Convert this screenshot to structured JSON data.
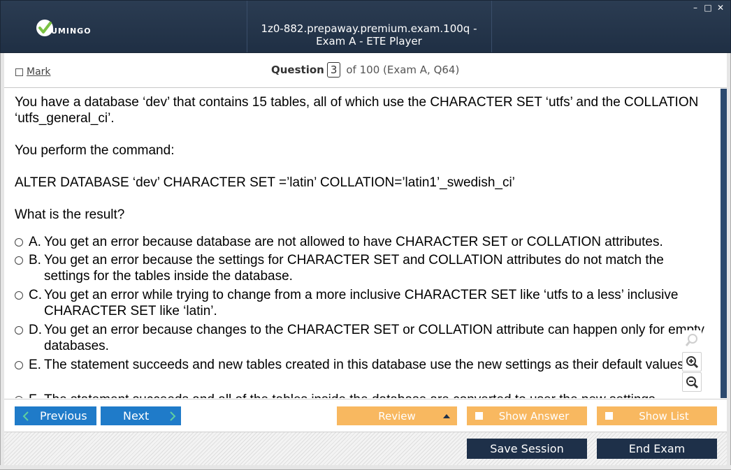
{
  "window": {
    "title": "1z0-882.prepaway.premium.exam.100q - Exam A - ETE Player",
    "logo_text": "UMINGO",
    "controls": [
      "–",
      "□",
      "✕"
    ]
  },
  "header": {
    "mark_label": "Mark",
    "question_label": "Question",
    "question_number": "3",
    "question_suffix": "of 100 (Exam A, Q64)"
  },
  "question": {
    "paragraphs": [
      "You have a database ‘dev’ that contains 15 tables, all of which use the CHARACTER SET ‘utfs’ and the COLLATION ‘utfs_general_ci’.",
      "You perform the command:",
      "ALTER DATABASE ‘dev’ CHARACTER SET =’latin’ COLLATION=’latin1’_swedish_ci’",
      "What is the result?"
    ],
    "options": [
      {
        "letter": "A.",
        "text": "You get an error because database are not allowed to have CHARACTER SET or COLLATION attributes."
      },
      {
        "letter": "B.",
        "text": "You get an error because the settings for CHARACTER SET and COLLATION attributes do not match the settings for the tables inside the database."
      },
      {
        "letter": "C.",
        "text": "You get an error while trying to change from a more inclusive CHARACTER SET like ‘utfs to a less’ inclusive CHARACTER SET like ‘latin’."
      },
      {
        "letter": "D.",
        "text": "You get an error because changes to the CHARACTER SET or COLLATION attribute can happen only for empty databases."
      },
      {
        "letter": "E.",
        "text": "The statement succeeds and new tables created in this database use the new settings as their default values."
      },
      {
        "letter": "F.",
        "text": "The statement succeeds and all of the tables inside the database are converted to user the new settings."
      }
    ]
  },
  "nav": {
    "previous_label": "Previous",
    "next_label": "Next",
    "review_label": "Review",
    "show_answer_label": "Show Answer",
    "show_list_label": "Show List"
  },
  "footer": {
    "save_label": "Save Session",
    "end_label": "End Exam"
  },
  "colors": {
    "titlebar": "#1f2f44",
    "blue_button": "#1f7bc9",
    "orange_button": "#f8b860",
    "dark_button": "#1e3049",
    "logo_check": "#7ac142"
  }
}
